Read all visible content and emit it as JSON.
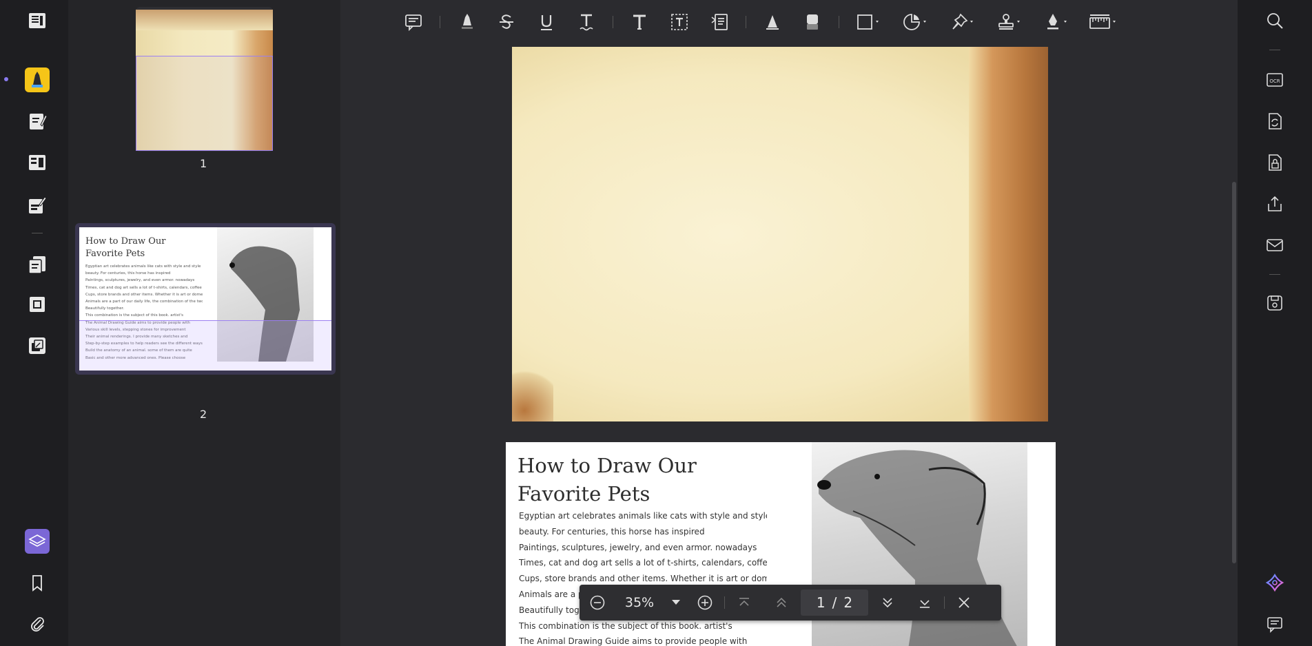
{
  "thumbnails": [
    {
      "page_number": "1"
    },
    {
      "page_number": "2"
    }
  ],
  "page2": {
    "title_line1": "How to Draw Our",
    "title_line2": "Favorite Pets",
    "body_lines": [
      "Egyptian art celebrates animals like cats with style and style",
      "beauty. For centuries, this horse has inspired",
      "Paintings, sculptures, jewelry, and even armor. nowadays",
      "Times, cat and dog art sells a lot of t-shirts, calendars, coffee",
      "Cups, store brands and other items. Whether it is art or domestic",
      "Animals are a part of our daily life, the combination of the two",
      "Beautifully together.",
      "This combination is the subject of this book. artist's",
      "The Animal Drawing Guide aims to provide people with"
    ],
    "visible_body_lines": [
      "Egyptian art celebrates animals like cats with style and style",
      "beauty. For centuries, this horse has inspired",
      "Paintings, sculptures, jewelry, and even armor. nowadays",
      "Times, cat and dog art sells a lot of t-shirts, calendars, coffee",
      "Cups, store brands and other items. Whether it is art or domestic",
      "Animals are a pa",
      "Beautifully toge",
      "This combination is the subject of this book. artist's",
      "The Animal Drawing Guide aims to provide people with"
    ]
  },
  "thumb2_lines": [
    "Egyptian art celebrates animals like cats with style and style",
    "beauty. For centuries, this horse has inspired",
    "Paintings, sculptures, jewelry, and even armor. nowadays",
    "Times, cat and dog art sells a lot of t-shirts, calendars, coffee",
    "Cups, store brands and other items. Whether it is art or domestic",
    "Animals are a part of our daily life, the combination of the two",
    "Beautifully together.",
    "This combination is the subject of this book. artist's",
    "The Animal Drawing Guide aims to provide people with",
    "Various skill levels, stepping stones for improvement",
    "Their animal renderings. I provide many sketches and",
    "Step-by-step examples to help readers see the different ways",
    "Build the anatomy of an animal. some of them are quite",
    "Basic and other more advanced ones. Please choose"
  ],
  "navbar": {
    "zoom": "35%",
    "current_page": "1",
    "separator": "/",
    "total_pages": "2"
  },
  "colors": {
    "accent_purple": "#7b67d6",
    "highlight_yellow": "#f5c518",
    "selection_border": "#9b7ff2"
  },
  "icons": {
    "left_rail": [
      "reader-icon",
      "comment-highlight-icon",
      "edit-pdf-icon",
      "form-icon",
      "sign-edit-icon",
      "organize-pages-icon",
      "crop-icon",
      "convert-icon",
      "layers-icon",
      "bookmark-icon",
      "attachment-icon"
    ],
    "toolbar": [
      "comment-icon",
      "highlighter-icon",
      "strikethrough-icon",
      "underline-icon",
      "squiggly-underline-icon",
      "text-icon",
      "textbox-icon",
      "text-callout-icon",
      "pencil-icon",
      "eraser-icon",
      "shape-icon",
      "sticker-icon",
      "pin-icon",
      "stamp-icon",
      "signature-icon",
      "measure-icon"
    ],
    "right_rail": [
      "search-icon",
      "ocr-icon",
      "convert-refresh-icon",
      "protect-icon",
      "share-icon",
      "email-icon",
      "save-icon",
      "ai-assistant-icon",
      "comments-panel-icon"
    ]
  }
}
